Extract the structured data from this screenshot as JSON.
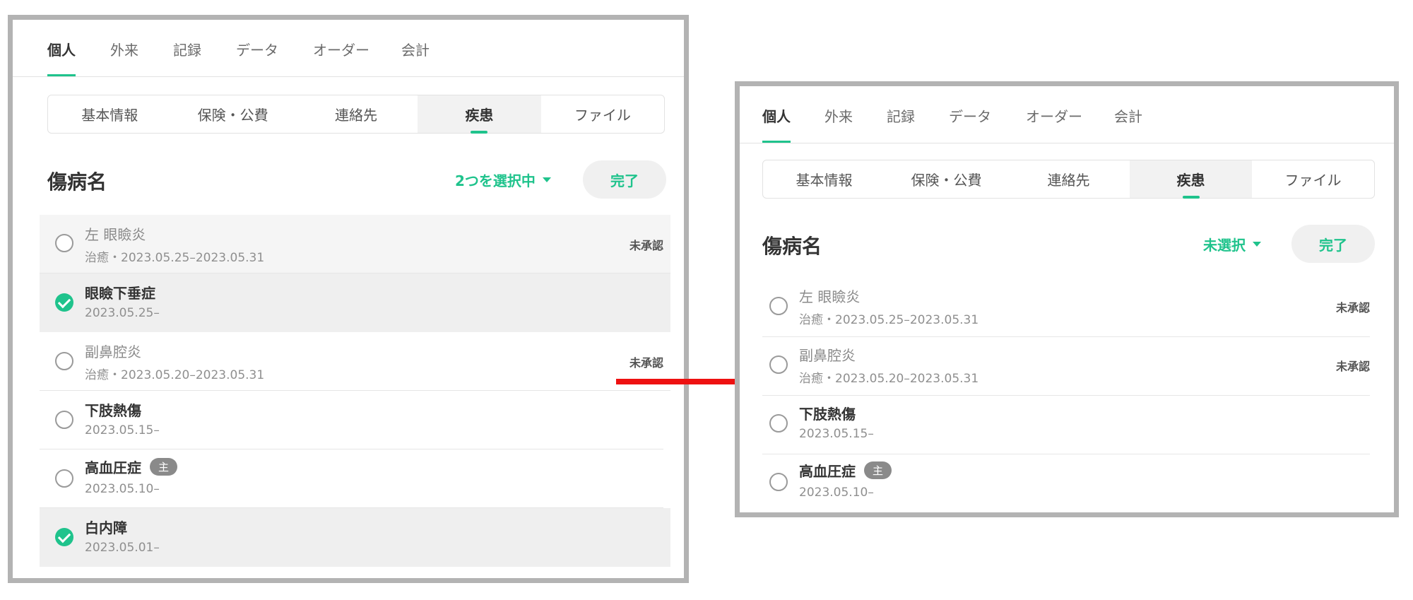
{
  "main_tabs": [
    "個人",
    "外来",
    "記録",
    "データ",
    "オーダー",
    "会計"
  ],
  "sub_tabs": [
    "基本情報",
    "保険・公費",
    "連絡先",
    "疾患",
    "ファイル"
  ],
  "section_title": "傷病名",
  "done_label": "完了",
  "left_panel": {
    "selection_label": "2つを選択中",
    "items": [
      {
        "name": "左 眼瞼炎",
        "date": "治癒・2023.05.25–2023.05.31",
        "status": "未承認",
        "checked": false,
        "muted": true
      },
      {
        "name": "眼瞼下垂症",
        "date": "2023.05.25–",
        "status": "",
        "checked": true,
        "muted": false
      },
      {
        "name": "副鼻腔炎",
        "date": "治癒・2023.05.20–2023.05.31",
        "status": "未承認",
        "checked": false,
        "muted": true
      },
      {
        "name": "下肢熱傷",
        "date": "2023.05.15–",
        "status": "",
        "checked": false,
        "muted": false
      },
      {
        "name": "高血圧症",
        "badge": "主",
        "date": "2023.05.10–",
        "status": "",
        "checked": false,
        "muted": false
      },
      {
        "name": "白内障",
        "date": "2023.05.01–",
        "status": "",
        "checked": true,
        "muted": false
      }
    ]
  },
  "right_panel": {
    "selection_label": "未選択",
    "items": [
      {
        "name": "左 眼瞼炎",
        "date": "治癒・2023.05.25–2023.05.31",
        "status": "未承認",
        "checked": false,
        "muted": true
      },
      {
        "name": "副鼻腔炎",
        "date": "治癒・2023.05.20–2023.05.31",
        "status": "未承認",
        "checked": false,
        "muted": true
      },
      {
        "name": "下肢熱傷",
        "date": "2023.05.15–",
        "status": "",
        "checked": false,
        "muted": false
      },
      {
        "name": "高血圧症",
        "badge": "主",
        "date": "2023.05.10–",
        "status": "",
        "checked": false,
        "muted": false
      }
    ]
  },
  "colors": {
    "accent": "#1fc38c",
    "arrow": "#ee1111",
    "panel_border": "#b3b3b3"
  }
}
